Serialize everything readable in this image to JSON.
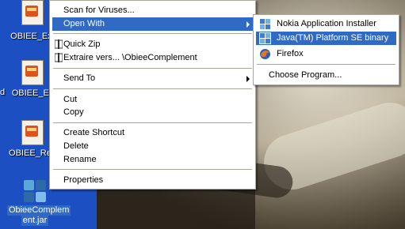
{
  "desktop": {
    "icons": [
      {
        "label": "OBIEE_Ext"
      },
      {
        "label": "OBIEE_Ex"
      },
      {
        "label": "OBIEE_Rep"
      },
      {
        "label": "ObieeComplem"
      },
      {
        "label": "ent.jar"
      }
    ],
    "stray_letter": "d"
  },
  "context_menu": {
    "items": {
      "scan": "Scan for Viruses...",
      "open_with": "Open With",
      "quick_zip": "Quick Zip",
      "extract": "Extraire vers... \\ObieeComplement",
      "send_to": "Send To",
      "cut": "Cut",
      "copy": "Copy",
      "create_shortcut": "Create Shortcut",
      "delete": "Delete",
      "rename": "Rename",
      "properties": "Properties"
    },
    "highlight_color": "#316ac5"
  },
  "open_with_menu": {
    "items": [
      {
        "label": "Nokia Application Installer",
        "icon": "nokia-installer-icon"
      },
      {
        "label": "Java(TM) Platform SE binary",
        "icon": "java-icon"
      },
      {
        "label": "Firefox",
        "icon": "firefox-icon"
      }
    ],
    "choose": "Choose Program..."
  }
}
